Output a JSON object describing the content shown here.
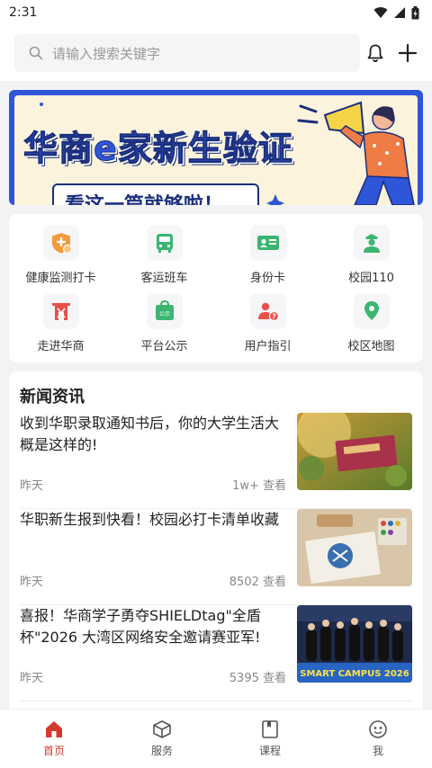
{
  "status_bar": {
    "time": "2:31"
  },
  "search": {
    "placeholder": "请输入搜索关键字"
  },
  "banner": {
    "title": "华商e家新生验证",
    "subtitle": "看这一篇就够啦！"
  },
  "grid": [
    {
      "label": "健康监测打卡",
      "icon": "health-shield-icon",
      "color": "#f39a3a"
    },
    {
      "label": "客运班车",
      "icon": "bus-icon",
      "color": "#3bb56f"
    },
    {
      "label": "身份卡",
      "icon": "id-card-icon",
      "color": "#3bb56f"
    },
    {
      "label": "校园110",
      "icon": "police-icon",
      "color": "#3bb56f"
    },
    {
      "label": "走进华商",
      "icon": "gate-icon",
      "color": "#e8514a"
    },
    {
      "label": "平台公示",
      "icon": "notice-bag-icon",
      "color": "#3bb56f"
    },
    {
      "label": "用户指引",
      "icon": "user-help-icon",
      "color": "#e8514a"
    },
    {
      "label": "校区地图",
      "icon": "map-pin-icon",
      "color": "#3bb56f"
    }
  ],
  "news": {
    "title": "新闻资讯",
    "items": [
      {
        "headline": "收到华职录取通知书后，你的大学生活大概是这样的!",
        "date": "昨天",
        "views": "1w+ 查看"
      },
      {
        "headline": "华职新生报到快看！校园必打卡清单收藏",
        "date": "昨天",
        "views": "8502 查看"
      },
      {
        "headline": "喜报！华商学子勇夺SHIELDtag\"全盾杯\"2026 大湾区网络安全邀请赛亚军!",
        "date": "昨天",
        "views": "5395 查看"
      }
    ],
    "thumb3_text": "SMART CAMPUS 2026"
  },
  "tabs": [
    {
      "label": "首页",
      "icon": "home-icon"
    },
    {
      "label": "服务",
      "icon": "service-box-icon"
    },
    {
      "label": "课程",
      "icon": "course-book-icon"
    },
    {
      "label": "我",
      "icon": "profile-face-icon"
    }
  ],
  "colors": {
    "accent": "#d23b2f",
    "green": "#3bb56f",
    "banner_blue": "#2f55d8"
  }
}
